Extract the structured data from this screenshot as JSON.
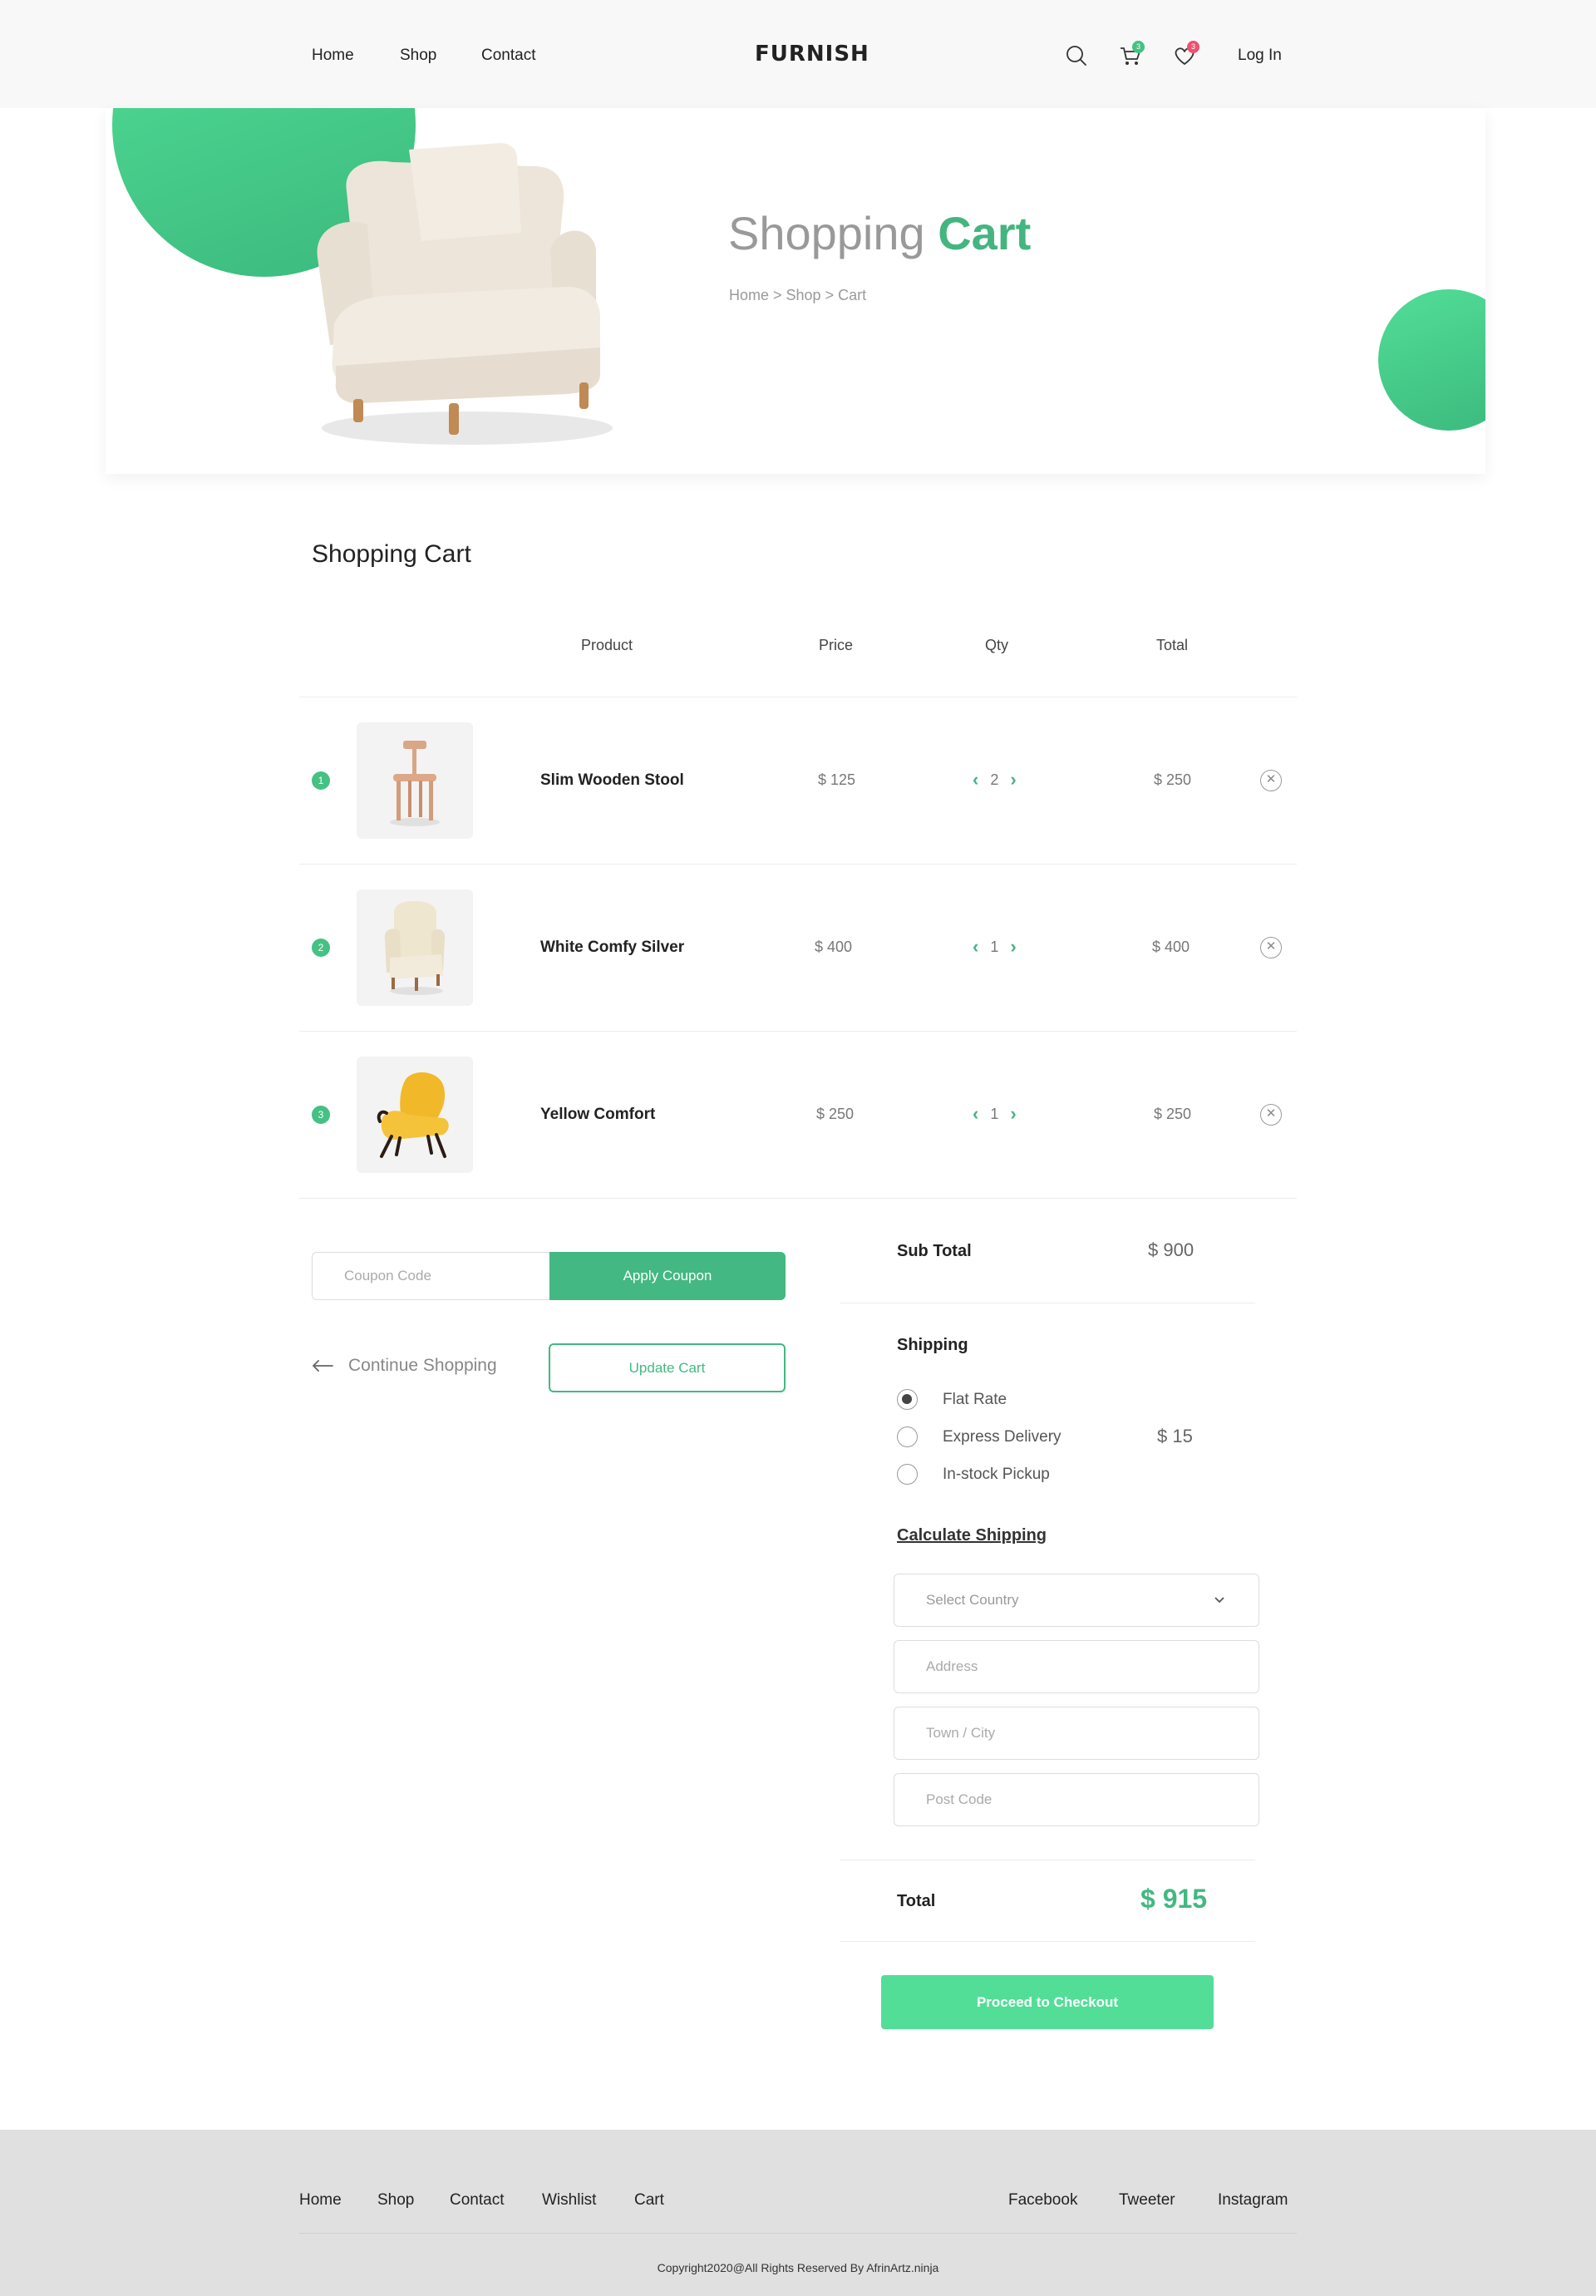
{
  "nav": {
    "links": [
      "Home",
      "Shop",
      "Contact"
    ],
    "logo": "FURNISH",
    "cart_count": "3",
    "wishlist_count": "3",
    "login": "Log In",
    "icons": [
      "search-icon",
      "cart-icon",
      "heart-icon"
    ]
  },
  "hero": {
    "title_light": "Shopping ",
    "title_bold": "Cart",
    "breadcrumb": [
      "Home",
      "Shop",
      "Cart"
    ],
    "breadcrumb_sep": " > "
  },
  "cart": {
    "title": "Shopping Cart",
    "headers": {
      "product": "Product",
      "price": "Price",
      "qty": "Qty",
      "total": "Total"
    },
    "items": [
      {
        "num": "1",
        "name": "Slim Wooden Stool",
        "price": "$ 125",
        "qty": "2",
        "total": "$ 250"
      },
      {
        "num": "2",
        "name": "White Comfy Silver",
        "price": "$ 400",
        "qty": "1",
        "total": "$ 400"
      },
      {
        "num": "3",
        "name": "Yellow Comfort",
        "price": "$ 250",
        "qty": "1",
        "total": "$ 250"
      }
    ]
  },
  "coupon": {
    "placeholder": "Coupon Code",
    "apply": "Apply Coupon",
    "continue": "Continue Shopping",
    "update": "Update Cart"
  },
  "summary": {
    "subtotal_label": "Sub Total",
    "subtotal": "$ 900",
    "shipping_label": "Shipping",
    "options": [
      {
        "label": "Flat Rate",
        "selected": true
      },
      {
        "label": "Express Delivery",
        "selected": false
      },
      {
        "label": "In-stock Pickup",
        "selected": false
      }
    ],
    "shipping_cost": "$ 15",
    "calc_label": "Calculate Shipping",
    "country_placeholder": "Select Country",
    "address_placeholder": "Address",
    "city_placeholder": "Town / City",
    "postcode_placeholder": "Post Code",
    "total_label": "Total",
    "total": "$ 915",
    "checkout": "Proceed to Checkout"
  },
  "footer": {
    "links": [
      "Home",
      "Shop",
      "Contact",
      "Wishlist",
      "Cart"
    ],
    "social": [
      "Facebook",
      "Tweeter",
      "Instagram"
    ],
    "copyright": "Copyright2020@All Rights Reserved By AfrinArtz.ninja"
  },
  "colors": {
    "accent": "#43b882",
    "accent_light": "#52de97",
    "badge_cart": "#44c183",
    "badge_wishlist": "#f0506e"
  }
}
